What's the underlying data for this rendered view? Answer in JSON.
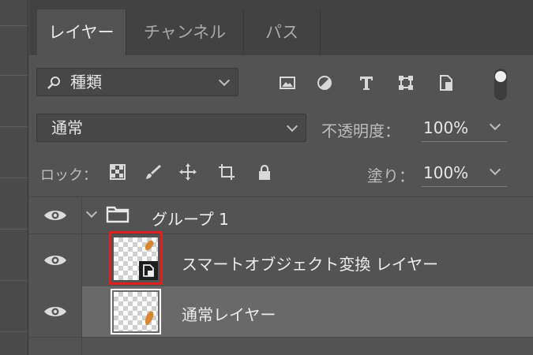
{
  "tabs": [
    {
      "label": "レイヤー",
      "active": true
    },
    {
      "label": "チャンネル",
      "active": false
    },
    {
      "label": "パス",
      "active": false
    }
  ],
  "filter": {
    "kind_label": "種類",
    "icons": [
      "image-filter-icon",
      "adjustment-filter-icon",
      "type-filter-icon",
      "shape-filter-icon",
      "smart-object-filter-icon"
    ],
    "toggle_on": true
  },
  "blend": {
    "mode": "通常",
    "opacity_label": "不透明度：",
    "opacity_value": "100%"
  },
  "lock": {
    "label": "ロック：",
    "fill_label": "塗り：",
    "fill_value": "100%"
  },
  "layers": [
    {
      "type": "group",
      "name": "グループ 1",
      "visible": true,
      "expanded": true
    },
    {
      "type": "smart-object",
      "name": "スマートオブジェクト変換 レイヤー",
      "visible": true,
      "highlighted_thumbnail": true
    },
    {
      "type": "normal",
      "name": "通常レイヤー",
      "visible": true,
      "selected": true
    }
  ],
  "colors": {
    "panel_bg": "#535353",
    "selected_row": "#696969",
    "highlight": "#e02020",
    "sprite_orange": "#d9862e"
  }
}
